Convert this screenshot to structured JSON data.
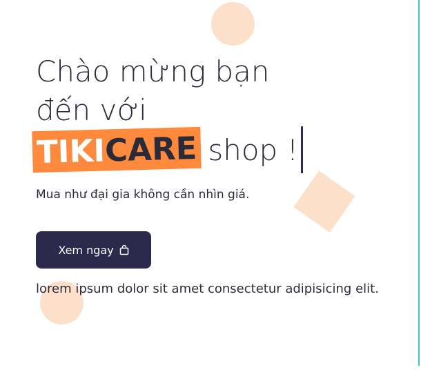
{
  "hero": {
    "heading_line1": "Chào mừng bạn",
    "heading_line2": "đến với",
    "brand_tiki": "TIKI",
    "brand_care": "CARE",
    "brand_suffix": "shop !",
    "subtitle": "Mua như đại gia không cần nhìn giá.",
    "cta_label": "Xem ngay",
    "cta_icon": "shopping-bag-icon",
    "description": "lorem ipsum dolor sit amet consectetur adipisicing elit."
  },
  "colors": {
    "accent_orange": "#ff8a3d",
    "button_dark": "#2b2a4c",
    "decor_peach": "#fde0c9",
    "border_teal": "#3fc4cf"
  }
}
